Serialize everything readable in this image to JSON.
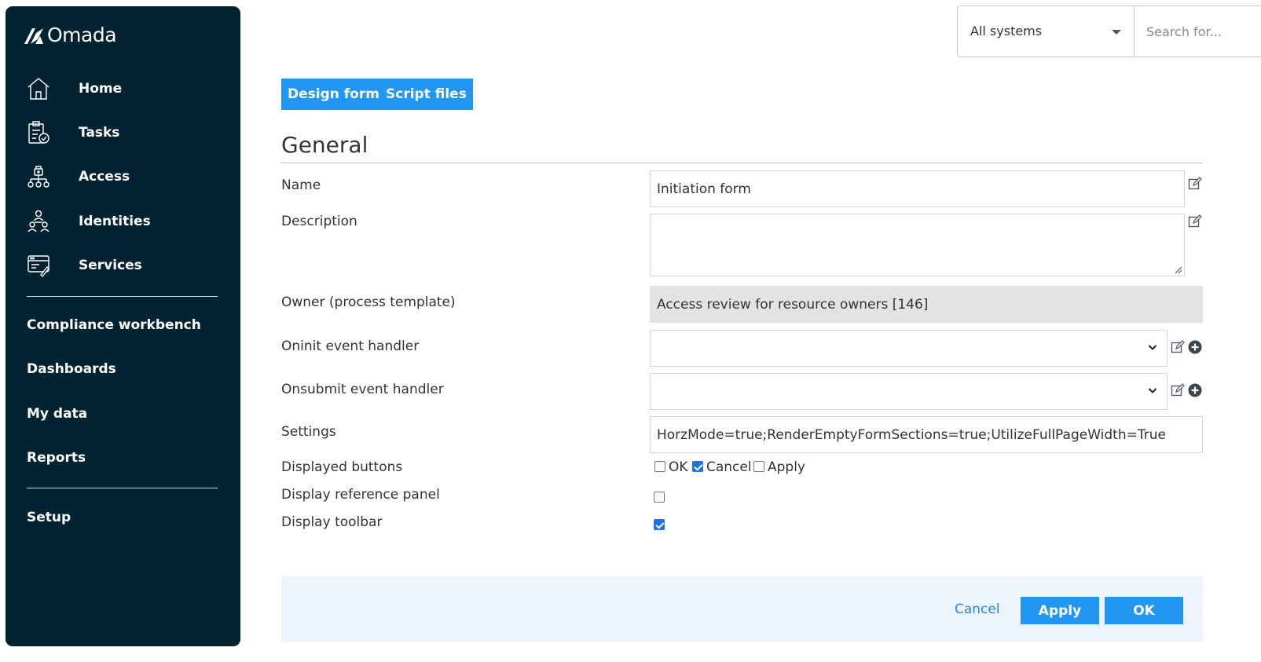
{
  "app": {
    "logo_text": "Omada"
  },
  "sidebar": {
    "items": [
      {
        "label": "Home",
        "icon": "home-icon"
      },
      {
        "label": "Tasks",
        "icon": "clipboard-check-icon"
      },
      {
        "label": "Access",
        "icon": "access-tree-icon"
      },
      {
        "label": "Identities",
        "icon": "identities-icon"
      },
      {
        "label": "Services",
        "icon": "services-icon"
      }
    ],
    "links": [
      "Compliance workbench",
      "Dashboards",
      "My data",
      "Reports"
    ],
    "setup": "Setup"
  },
  "topbar": {
    "system_select": "All systems",
    "search_placeholder": "Search for..."
  },
  "tabs": [
    "Design form",
    "Script files"
  ],
  "section": {
    "title": "General"
  },
  "form": {
    "name_label": "Name",
    "name_value": "Initiation form",
    "description_label": "Description",
    "description_value": "",
    "owner_label": "Owner (process template)",
    "owner_value": "Access review for resource owners [146]",
    "oninit_label": "Oninit event handler",
    "oninit_value": "",
    "onsubmit_label": "Onsubmit event handler",
    "onsubmit_value": "",
    "settings_label": "Settings",
    "settings_value": "HorzMode=true;RenderEmptyFormSections=true;UtilizeFullPageWidth=True",
    "displayed_buttons_label": "Displayed buttons",
    "displayed_buttons": [
      {
        "label": "OK",
        "checked": false
      },
      {
        "label": "Cancel",
        "checked": true
      },
      {
        "label": "Apply",
        "checked": false
      }
    ],
    "reference_panel_label": "Display reference panel",
    "reference_panel_checked": false,
    "toolbar_label": "Display toolbar",
    "toolbar_checked": true
  },
  "footer": {
    "cancel": "Cancel",
    "apply": "Apply",
    "ok": "OK"
  },
  "colors": {
    "sidebar_bg": "#032333",
    "accent": "#2196f3",
    "footer_bg": "#eef4fb",
    "disabled_bg": "#e3e3e3"
  }
}
